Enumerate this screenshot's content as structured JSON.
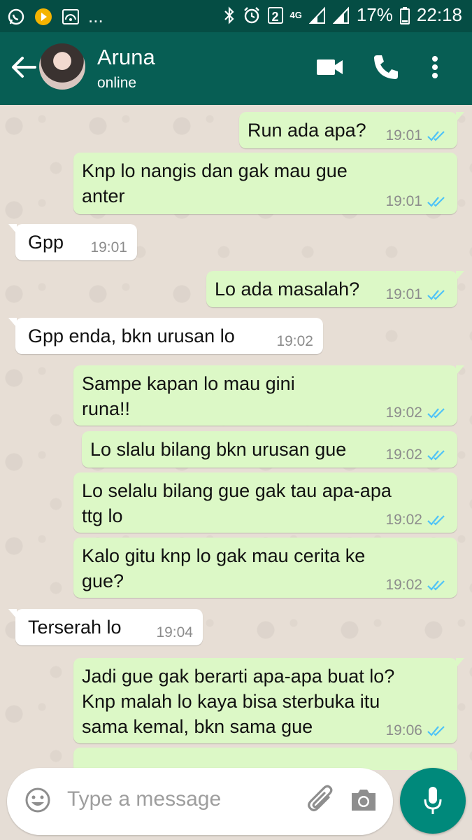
{
  "status_bar": {
    "icons": [
      "whatsapp-icon",
      "app-icon",
      "cast-icon",
      "more-dots",
      "bluetooth-icon",
      "alarm-icon",
      "sim-icon",
      "network-4g-icon",
      "signal-icon",
      "signal-icon",
      "battery-icon"
    ],
    "overflow": "...",
    "sim_number": "2",
    "network_label": "4G",
    "battery_percent": "17%",
    "time": "22:18"
  },
  "header": {
    "contact_name": "Aruna",
    "contact_status": "online",
    "colors": {
      "bar": "#075e54",
      "status_bar": "#054d44"
    }
  },
  "messages": [
    {
      "direction": "out",
      "text": "Run ada apa?",
      "time": "19:01",
      "read": true
    },
    {
      "direction": "out",
      "text": "Knp lo nangis dan gak mau gue\nanter",
      "time": "19:01",
      "read": true
    },
    {
      "direction": "in",
      "text": "Gpp",
      "time": "19:01"
    },
    {
      "direction": "out",
      "text": "Lo ada masalah?",
      "time": "19:01",
      "read": true
    },
    {
      "direction": "in",
      "text": "Gpp enda, bkn urusan lo",
      "time": "19:02"
    },
    {
      "direction": "out",
      "text": "Sampe kapan lo mau gini\nruna!!",
      "time": "19:02",
      "read": true
    },
    {
      "direction": "out",
      "text": "Lo slalu bilang bkn urusan gue",
      "time": "19:02",
      "read": true
    },
    {
      "direction": "out",
      "text": "Lo selalu bilang gue gak tau apa-apa\nttg lo",
      "time": "19:02",
      "read": true
    },
    {
      "direction": "out",
      "text": "Kalo gitu knp lo gak mau cerita ke\ngue?",
      "time": "19:02",
      "read": true
    },
    {
      "direction": "in",
      "text": "Terserah lo",
      "time": "19:04"
    },
    {
      "direction": "out",
      "text": "Jadi gue gak berarti apa-apa buat lo?\nKnp malah lo kaya bisa sterbuka itu\nsama kemal, bkn sama gue",
      "time": "19:06",
      "read": true
    }
  ],
  "composer": {
    "placeholder": "Type a message",
    "colors": {
      "send_button": "#00897b",
      "outgoing_bubble": "#dcf8c6",
      "read_ticks": "#4fc3f7"
    }
  }
}
